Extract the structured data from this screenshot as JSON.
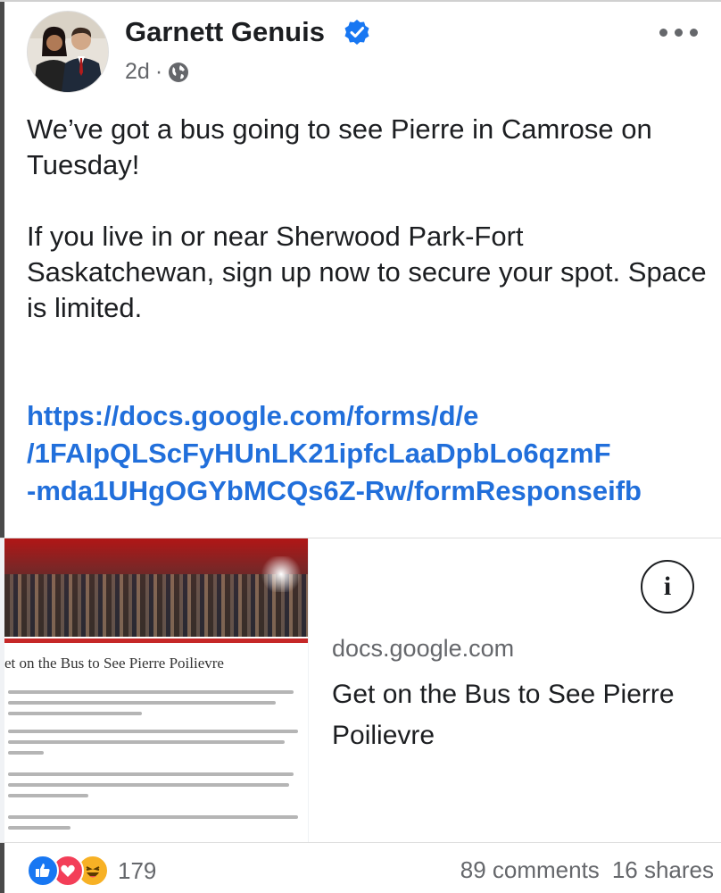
{
  "post": {
    "author": "Garnett Genuis",
    "timestamp": "2d",
    "separator": "·",
    "verified": true,
    "privacy_icon": "globe-icon",
    "more_icon": "more-horizontal-icon",
    "paragraphs": [
      "We’ve got a bus going to see Pierre in Camrose on Tuesday!",
      "If you live in or near Sherwood Park-Fort Saskatchewan, sign up now to secure your spot. Space is limited."
    ],
    "link_lines": [
      "https://docs.google.com/forms/d/e",
      "/1FAIpQLScFyHUnLK21ipfcLaaDpbLo6qzmF",
      "-mda1UHgOGYbMCQs6Z-Rw/formResponseifb"
    ]
  },
  "link_preview": {
    "thumbnail_heading": "et on the Bus to See Pierre Poilievre",
    "domain": "docs.google.com",
    "title": "Get on the Bus to See Pierre Poilievre",
    "info_label": "i"
  },
  "engagement": {
    "reaction_icons": [
      "like-icon",
      "love-icon",
      "haha-icon"
    ],
    "reaction_count": "179",
    "comments": "89 comments",
    "shares": "16 shares"
  },
  "colors": {
    "link": "#216fdb",
    "verified": "#1877f2",
    "secondary_text": "#65676b",
    "like": "#1877f2",
    "love": "#f33e58",
    "haha": "#f7b125"
  }
}
